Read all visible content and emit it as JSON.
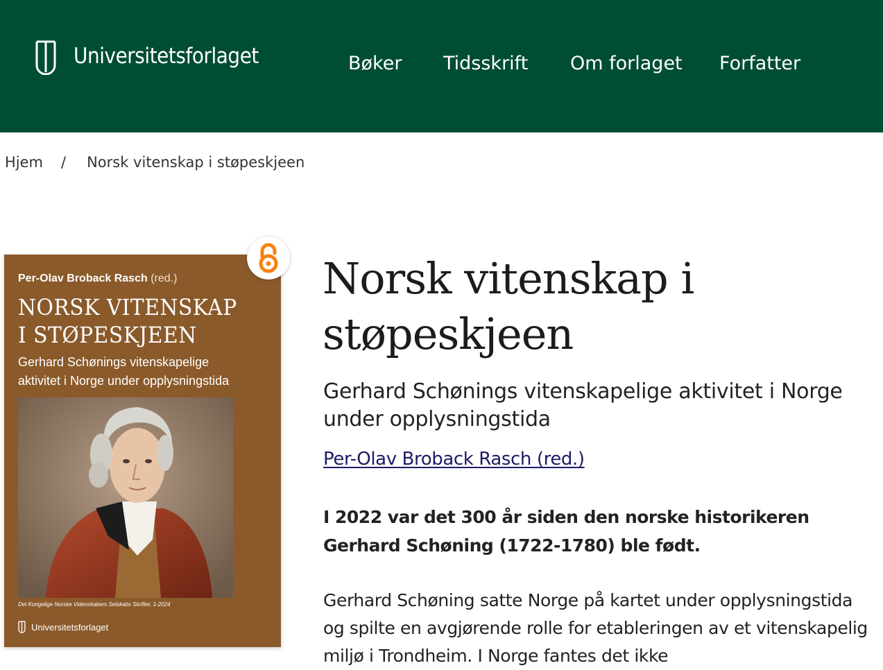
{
  "header": {
    "logo_text": "Universitetsforlaget",
    "nav": [
      "Bøker",
      "Tidsskrift",
      "Om forlaget",
      "Forfatter"
    ],
    "background_color": "#004d35"
  },
  "breadcrumb": {
    "home": "Hjem",
    "separator": "/",
    "current": "Norsk vitenskap i støpeskjeen"
  },
  "cover": {
    "author": "Per-Olav Broback Rasch",
    "author_suffix": "(red.)",
    "title_lines": [
      "Norsk vitenskap",
      "i støpeskjeen"
    ],
    "subtitle_lines": [
      "Gerhard Schønings vitenskapelige",
      "aktivitet i Norge under opplysningstida"
    ],
    "series": "Det Kongelige Norske Videnskabers Selskabs Skrifter, 1-2024",
    "publisher": "Universitetsforlaget",
    "background_color": "#8b5a2b",
    "open_access_icon": "open-access-lock-icon",
    "open_access_color": "#f68212"
  },
  "book": {
    "title": "Norsk vitenskap i støpeskjeen",
    "subtitle": "Gerhard Schønings vitenskapelige aktivitet i Norge under opplysningstida",
    "author_link": "Per-Olav Broback Rasch (red.)",
    "lead": "I 2022 var det 300 år siden den norske historikeren Gerhard Schøning (1722-1780) ble født.",
    "description": "Gerhard Schøning satte Norge på kartet under opplysningstida og spilte en avgjørende rolle for etableringen av et vitenskapelig miljø i Trondheim. I Norge fantes det ikke"
  }
}
